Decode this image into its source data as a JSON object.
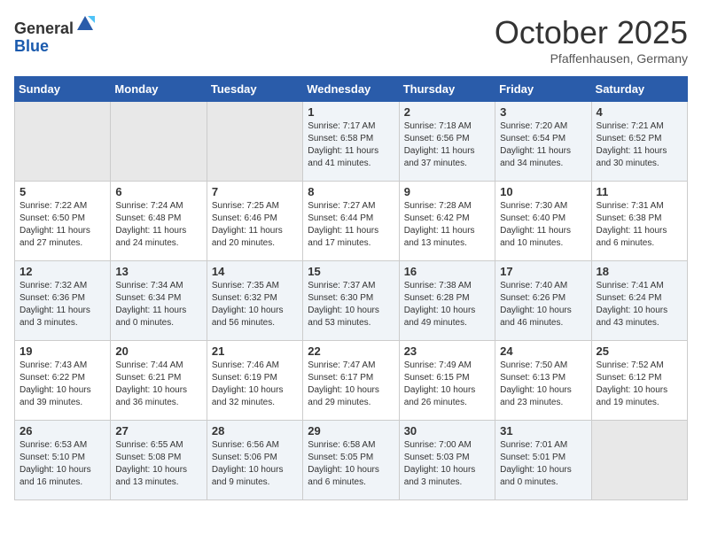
{
  "header": {
    "logo_general": "General",
    "logo_blue": "Blue",
    "month": "October 2025",
    "location": "Pfaffenhausen, Germany"
  },
  "weekdays": [
    "Sunday",
    "Monday",
    "Tuesday",
    "Wednesday",
    "Thursday",
    "Friday",
    "Saturday"
  ],
  "weeks": [
    [
      {
        "day": "",
        "empty": true
      },
      {
        "day": "",
        "empty": true
      },
      {
        "day": "",
        "empty": true
      },
      {
        "day": "1",
        "sunrise": "7:17 AM",
        "sunset": "6:58 PM",
        "daylight": "11 hours and 41 minutes."
      },
      {
        "day": "2",
        "sunrise": "7:18 AM",
        "sunset": "6:56 PM",
        "daylight": "11 hours and 37 minutes."
      },
      {
        "day": "3",
        "sunrise": "7:20 AM",
        "sunset": "6:54 PM",
        "daylight": "11 hours and 34 minutes."
      },
      {
        "day": "4",
        "sunrise": "7:21 AM",
        "sunset": "6:52 PM",
        "daylight": "11 hours and 30 minutes."
      }
    ],
    [
      {
        "day": "5",
        "sunrise": "7:22 AM",
        "sunset": "6:50 PM",
        "daylight": "11 hours and 27 minutes."
      },
      {
        "day": "6",
        "sunrise": "7:24 AM",
        "sunset": "6:48 PM",
        "daylight": "11 hours and 24 minutes."
      },
      {
        "day": "7",
        "sunrise": "7:25 AM",
        "sunset": "6:46 PM",
        "daylight": "11 hours and 20 minutes."
      },
      {
        "day": "8",
        "sunrise": "7:27 AM",
        "sunset": "6:44 PM",
        "daylight": "11 hours and 17 minutes."
      },
      {
        "day": "9",
        "sunrise": "7:28 AM",
        "sunset": "6:42 PM",
        "daylight": "11 hours and 13 minutes."
      },
      {
        "day": "10",
        "sunrise": "7:30 AM",
        "sunset": "6:40 PM",
        "daylight": "11 hours and 10 minutes."
      },
      {
        "day": "11",
        "sunrise": "7:31 AM",
        "sunset": "6:38 PM",
        "daylight": "11 hours and 6 minutes."
      }
    ],
    [
      {
        "day": "12",
        "sunrise": "7:32 AM",
        "sunset": "6:36 PM",
        "daylight": "11 hours and 3 minutes."
      },
      {
        "day": "13",
        "sunrise": "7:34 AM",
        "sunset": "6:34 PM",
        "daylight": "11 hours and 0 minutes."
      },
      {
        "day": "14",
        "sunrise": "7:35 AM",
        "sunset": "6:32 PM",
        "daylight": "10 hours and 56 minutes."
      },
      {
        "day": "15",
        "sunrise": "7:37 AM",
        "sunset": "6:30 PM",
        "daylight": "10 hours and 53 minutes."
      },
      {
        "day": "16",
        "sunrise": "7:38 AM",
        "sunset": "6:28 PM",
        "daylight": "10 hours and 49 minutes."
      },
      {
        "day": "17",
        "sunrise": "7:40 AM",
        "sunset": "6:26 PM",
        "daylight": "10 hours and 46 minutes."
      },
      {
        "day": "18",
        "sunrise": "7:41 AM",
        "sunset": "6:24 PM",
        "daylight": "10 hours and 43 minutes."
      }
    ],
    [
      {
        "day": "19",
        "sunrise": "7:43 AM",
        "sunset": "6:22 PM",
        "daylight": "10 hours and 39 minutes."
      },
      {
        "day": "20",
        "sunrise": "7:44 AM",
        "sunset": "6:21 PM",
        "daylight": "10 hours and 36 minutes."
      },
      {
        "day": "21",
        "sunrise": "7:46 AM",
        "sunset": "6:19 PM",
        "daylight": "10 hours and 32 minutes."
      },
      {
        "day": "22",
        "sunrise": "7:47 AM",
        "sunset": "6:17 PM",
        "daylight": "10 hours and 29 minutes."
      },
      {
        "day": "23",
        "sunrise": "7:49 AM",
        "sunset": "6:15 PM",
        "daylight": "10 hours and 26 minutes."
      },
      {
        "day": "24",
        "sunrise": "7:50 AM",
        "sunset": "6:13 PM",
        "daylight": "10 hours and 23 minutes."
      },
      {
        "day": "25",
        "sunrise": "7:52 AM",
        "sunset": "6:12 PM",
        "daylight": "10 hours and 19 minutes."
      }
    ],
    [
      {
        "day": "26",
        "sunrise": "6:53 AM",
        "sunset": "5:10 PM",
        "daylight": "10 hours and 16 minutes."
      },
      {
        "day": "27",
        "sunrise": "6:55 AM",
        "sunset": "5:08 PM",
        "daylight": "10 hours and 13 minutes."
      },
      {
        "day": "28",
        "sunrise": "6:56 AM",
        "sunset": "5:06 PM",
        "daylight": "10 hours and 9 minutes."
      },
      {
        "day": "29",
        "sunrise": "6:58 AM",
        "sunset": "5:05 PM",
        "daylight": "10 hours and 6 minutes."
      },
      {
        "day": "30",
        "sunrise": "7:00 AM",
        "sunset": "5:03 PM",
        "daylight": "10 hours and 3 minutes."
      },
      {
        "day": "31",
        "sunrise": "7:01 AM",
        "sunset": "5:01 PM",
        "daylight": "10 hours and 0 minutes."
      },
      {
        "day": "",
        "empty": true
      }
    ]
  ]
}
